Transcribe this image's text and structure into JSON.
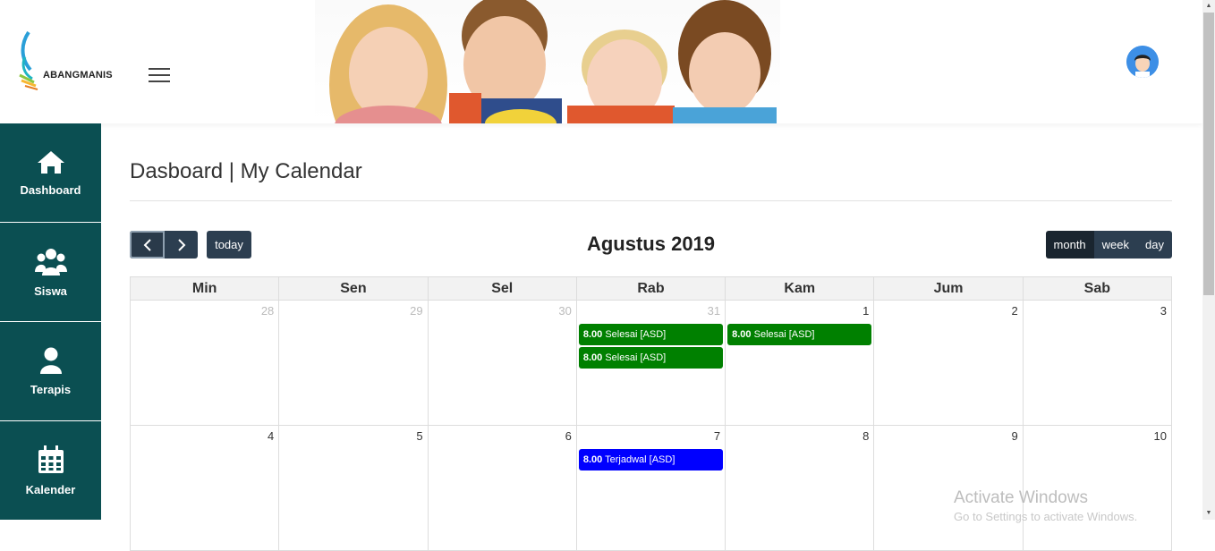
{
  "app": {
    "logo_text": "ABANGMANIS"
  },
  "sidebar": {
    "items": [
      {
        "label": "Dashboard",
        "icon": "home-icon"
      },
      {
        "label": "Siswa",
        "icon": "users-icon"
      },
      {
        "label": "Terapis",
        "icon": "user-icon"
      },
      {
        "label": "Kalender",
        "icon": "calendar-icon"
      }
    ]
  },
  "page": {
    "title": "Dasboard | My Calendar"
  },
  "calendar": {
    "title": "Agustus 2019",
    "today_label": "today",
    "views": [
      "month",
      "week",
      "day"
    ],
    "active_view": "month",
    "weekdays": [
      "Min",
      "Sen",
      "Sel",
      "Rab",
      "Kam",
      "Jum",
      "Sab"
    ],
    "weeks": [
      {
        "days": [
          {
            "num": "28",
            "other": true,
            "events": []
          },
          {
            "num": "29",
            "other": true,
            "events": []
          },
          {
            "num": "30",
            "other": true,
            "events": []
          },
          {
            "num": "31",
            "other": true,
            "events": [
              {
                "time": "8.00",
                "title": "Selesai [ASD]",
                "color": "#008000"
              },
              {
                "time": "8.00",
                "title": "Selesai [ASD]",
                "color": "#008000"
              }
            ]
          },
          {
            "num": "1",
            "other": false,
            "events": [
              {
                "time": "8.00",
                "title": "Selesai [ASD]",
                "color": "#008000"
              }
            ]
          },
          {
            "num": "2",
            "other": false,
            "events": []
          },
          {
            "num": "3",
            "other": false,
            "events": []
          }
        ]
      },
      {
        "days": [
          {
            "num": "4",
            "other": false,
            "events": []
          },
          {
            "num": "5",
            "other": false,
            "events": []
          },
          {
            "num": "6",
            "other": false,
            "events": []
          },
          {
            "num": "7",
            "other": false,
            "events": [
              {
                "time": "8.00",
                "title": "Terjadwal [ASD]",
                "color": "#0000ff"
              }
            ]
          },
          {
            "num": "8",
            "other": false,
            "events": []
          },
          {
            "num": "9",
            "other": false,
            "events": []
          },
          {
            "num": "10",
            "other": false,
            "events": []
          }
        ]
      }
    ]
  },
  "watermark": {
    "line1": "Activate Windows",
    "line2": "Go to Settings to activate Windows."
  }
}
